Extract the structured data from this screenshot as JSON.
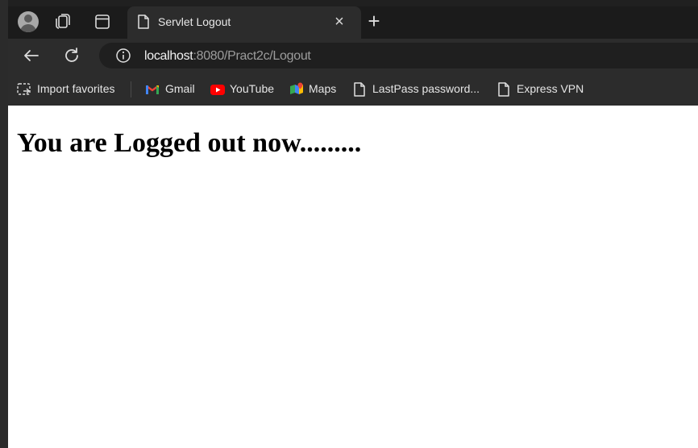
{
  "tab": {
    "title": "Servlet Logout"
  },
  "address": {
    "host": "localhost",
    "rest": ":8080/Pract2c/Logout"
  },
  "bookmarks": [
    {
      "label": "Import favorites",
      "icon": "import-favorites-icon"
    },
    {
      "label": "Gmail",
      "icon": "gmail-icon"
    },
    {
      "label": "YouTube",
      "icon": "youtube-icon"
    },
    {
      "label": "Maps",
      "icon": "maps-icon"
    },
    {
      "label": "LastPass password...",
      "icon": "page-icon"
    },
    {
      "label": "Express VPN",
      "icon": "page-icon"
    }
  ],
  "page": {
    "heading": "You are Logged out now........."
  },
  "colors": {
    "chrome_dark": "#202020",
    "toolbar": "#2c2c2c",
    "page_bg": "#ffffff",
    "youtube_red": "#ff0000"
  }
}
